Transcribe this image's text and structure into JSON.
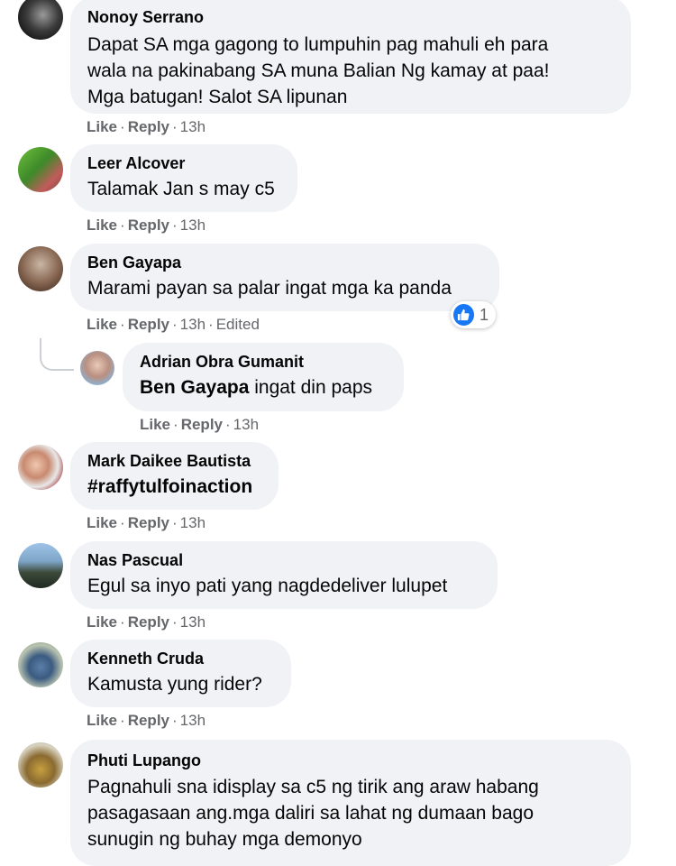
{
  "actions": {
    "like": "Like",
    "reply": "Reply",
    "edited": "Edited"
  },
  "comments": [
    {
      "author": "Nonoy Serrano",
      "text": "Dapat SA mga gagong to lumpuhin pag mahuli eh para\nwala na pakinabang SA muna Balian Ng kamay at paa!\nMga batugan! Salot SA lipunan",
      "time": "13h"
    },
    {
      "author": "Leer Alcover",
      "text": "Talamak Jan s may c5",
      "time": "13h"
    },
    {
      "author": "Ben Gayapa",
      "text": "Marami payan sa palar ingat mga ka panda",
      "time": "13h",
      "reaction_count": "1"
    },
    {
      "author": "Adrian Obra Gumanit",
      "mention": "Ben Gayapa",
      "text": " ingat din paps",
      "time": "13h"
    },
    {
      "author": "Mark Daikee Bautista",
      "text": "#raffytulfoinaction",
      "time": "13h"
    },
    {
      "author": "Nas Pascual",
      "text": "Egul sa inyo pati yang nagdedeliver lulupet",
      "time": "13h"
    },
    {
      "author": "Kenneth Cruda",
      "text": "Kamusta yung rider?",
      "time": "13h"
    },
    {
      "author": "Phuti Lupango",
      "text": "Pagnahuli sna idisplay sa c5 ng tirik ang araw habang\npasagasaan ang.mga daliri sa lahat ng dumaan bago\nsunugin ng buhay mga demonyo"
    }
  ],
  "colors": {
    "bubble": "#f0f2f5",
    "meta": "#65676b",
    "like_blue": "#1877f2"
  }
}
